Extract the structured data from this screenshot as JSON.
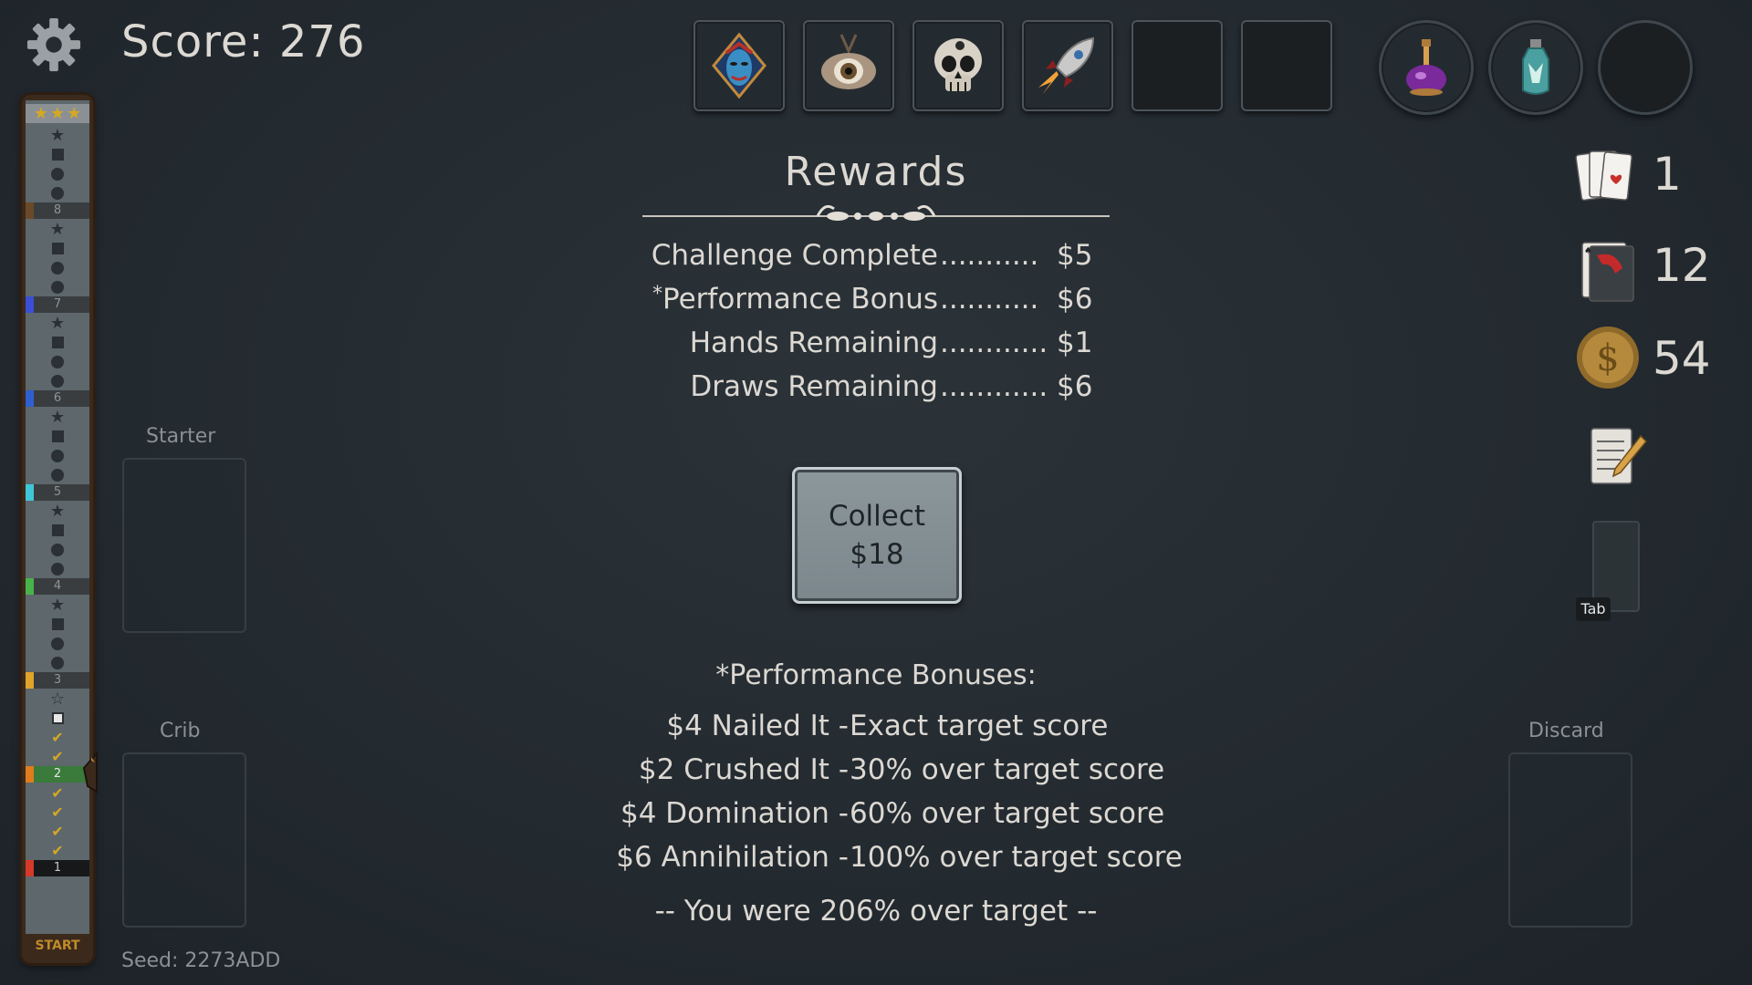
{
  "header": {
    "score": "Score: 276",
    "settings_icon": "gear-icon"
  },
  "jokers": [
    {
      "icon": "diamond-mask-icon"
    },
    {
      "icon": "eye-amulet-icon"
    },
    {
      "icon": "skull-icon"
    },
    {
      "icon": "rocket-icon"
    },
    {
      "icon": "empty-slot"
    },
    {
      "icon": "empty-slot"
    }
  ],
  "consumables": [
    {
      "icon": "purple-potion-icon"
    },
    {
      "icon": "teal-bottle-icon"
    },
    {
      "icon": "empty-slot"
    }
  ],
  "track": {
    "levels": [
      "8",
      "7",
      "6",
      "5",
      "4",
      "3",
      "2",
      "1"
    ],
    "level_colors": [
      "#6b4a2a",
      "#3a4fd6",
      "#2f5fd0",
      "#3fc7d8",
      "#49b34b",
      "#e0a42a",
      "#e07c1e",
      "#d43a2a"
    ],
    "start_label": "START"
  },
  "zones": {
    "starter": "Starter",
    "crib": "Crib",
    "discard": "Discard"
  },
  "rewards": {
    "title": "Rewards",
    "lines": [
      {
        "label": "Challenge Complete",
        "dots": "...........",
        "amount": "$5",
        "star": ""
      },
      {
        "label": "Performance Bonus",
        "dots": "...........",
        "amount": "$6",
        "star": "*"
      },
      {
        "label": "Hands Remaining",
        "dots": ".............",
        "amount": "$1",
        "star": ""
      },
      {
        "label": "Draws Remaining",
        "dots": ".............",
        "amount": "$6",
        "star": ""
      }
    ],
    "collect_line1": "Collect",
    "collect_line2": "$18"
  },
  "performance": {
    "title": "*Performance Bonuses:",
    "bonuses": [
      {
        "left": "$4 Nailed It -",
        "right": "Exact target score"
      },
      {
        "left": "$2 Crushed It -",
        "right": "30% over target score"
      },
      {
        "left": "$4 Domination -",
        "right": "60% over target score"
      },
      {
        "left": "$6 Annihilation -",
        "right": "100% over target score"
      }
    ],
    "summary": "-- You were 206% over target --"
  },
  "seed": "Seed: 2273ADD",
  "stats": {
    "hands": "1",
    "draws": "12",
    "money": "54",
    "tab_label": "Tab"
  }
}
